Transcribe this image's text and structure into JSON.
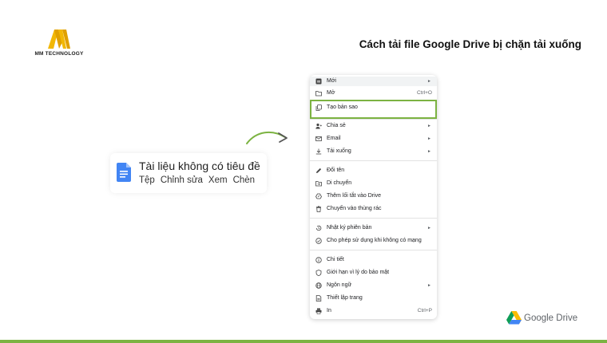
{
  "brand": {
    "name": "MM TECHNOLOGY"
  },
  "page": {
    "title": "Cách tải file Google Drive bị chặn tải xuống"
  },
  "doc": {
    "title": "Tài liệu không có tiêu đề",
    "menus": [
      "Tệp",
      "Chỉnh sửa",
      "Xem",
      "Chèn"
    ]
  },
  "menu": {
    "items": [
      {
        "label": "Mới",
        "icon": "new-doc-icon",
        "arrow": "►",
        "shortcut": ""
      },
      {
        "label": "Mở",
        "icon": "folder-icon",
        "arrow": "",
        "shortcut": "Ctrl+O"
      },
      {
        "label": "Tạo bản sao",
        "icon": "copy-icon",
        "arrow": "",
        "shortcut": ""
      },
      {
        "label": "Chia sẻ",
        "icon": "person-add-icon",
        "arrow": "►",
        "shortcut": ""
      },
      {
        "label": "Email",
        "icon": "mail-icon",
        "arrow": "►",
        "shortcut": ""
      },
      {
        "label": "Tải xuống",
        "icon": "download-icon",
        "arrow": "►",
        "shortcut": ""
      },
      {
        "label": "Đổi tên",
        "icon": "pencil-icon",
        "arrow": "",
        "shortcut": ""
      },
      {
        "label": "Di chuyển",
        "icon": "move-folder-icon",
        "arrow": "",
        "shortcut": ""
      },
      {
        "label": "Thêm lối tắt vào Drive",
        "icon": "drive-shortcut-icon",
        "arrow": "",
        "shortcut": ""
      },
      {
        "label": "Chuyển vào thùng rác",
        "icon": "trash-icon",
        "arrow": "",
        "shortcut": ""
      },
      {
        "label": "Nhật ký phiên bản",
        "icon": "history-icon",
        "arrow": "►",
        "shortcut": ""
      },
      {
        "label": "Cho phép sử dụng khi không có mạng",
        "icon": "offline-icon",
        "arrow": "",
        "shortcut": ""
      },
      {
        "label": "Chi tiết",
        "icon": "info-icon",
        "arrow": "",
        "shortcut": ""
      },
      {
        "label": "Giới hạn vì lý do bảo mật",
        "icon": "shield-icon",
        "arrow": "",
        "shortcut": ""
      },
      {
        "label": "Ngôn ngữ",
        "icon": "globe-icon",
        "arrow": "►",
        "shortcut": ""
      },
      {
        "label": "Thiết lập trang",
        "icon": "page-setup-icon",
        "arrow": "",
        "shortcut": ""
      },
      {
        "label": "In",
        "icon": "printer-icon",
        "arrow": "",
        "shortcut": "Ctrl+P"
      }
    ]
  },
  "footer": {
    "product": "Google Drive"
  },
  "colors": {
    "accent": "#7cb342",
    "logo_yellow": "#f2b705",
    "docs_blue": "#4285f4"
  }
}
